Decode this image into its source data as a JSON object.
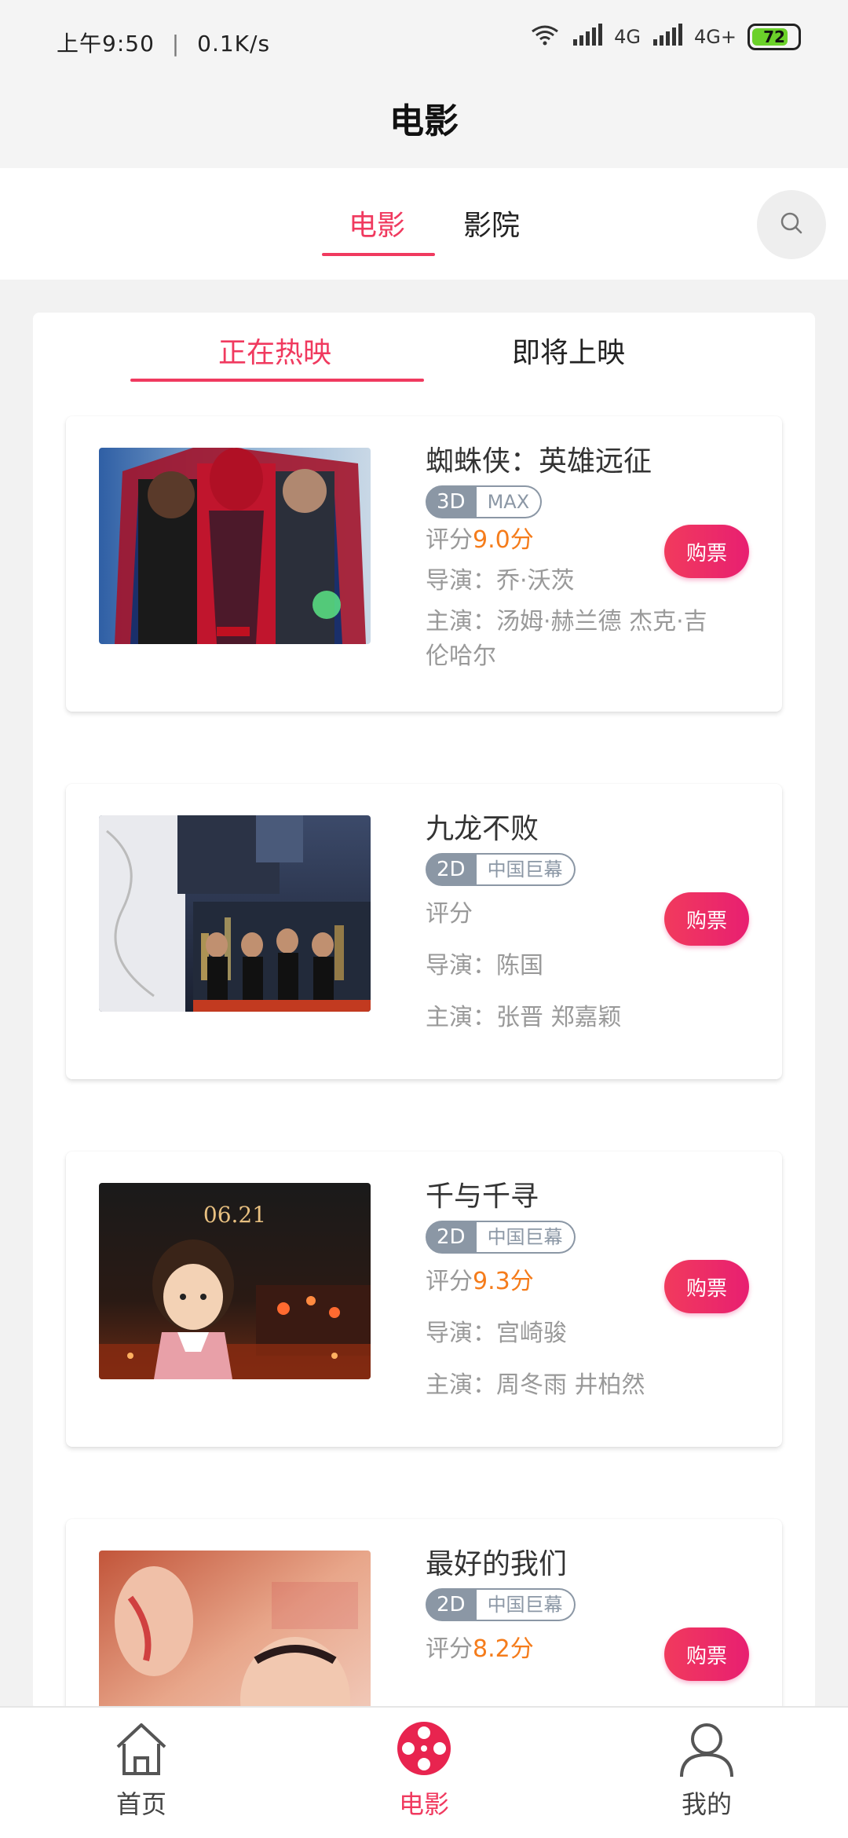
{
  "status_bar": {
    "time": "上午9:50",
    "speed": "0.1K/s",
    "net1": "4G",
    "net2": "4G+",
    "battery": "72"
  },
  "app_title": "电影",
  "top_tabs": [
    {
      "label": "电影",
      "active": true
    },
    {
      "label": "影院",
      "active": false
    }
  ],
  "sub_tabs": [
    {
      "label": "正在热映",
      "active": true
    },
    {
      "label": "即将上映",
      "active": false
    }
  ],
  "movies": [
    {
      "title": "蜘蛛侠：英雄远征",
      "dimension": "3D",
      "format": "MAX",
      "score_label": "评分",
      "score": "9.0分",
      "director": "导演：乔·沃茨",
      "cast": "主演：汤姆·赫兰德 杰克·吉伦哈尔",
      "buy_label": "购票"
    },
    {
      "title": "九龙不败",
      "dimension": "2D",
      "format": "中国巨幕",
      "score_label": "评分",
      "score": "",
      "director": "导演：陈国",
      "cast": "主演：张晋 郑嘉颖",
      "buy_label": "购票"
    },
    {
      "title": "千与千寻",
      "dimension": "2D",
      "format": "中国巨幕",
      "score_label": "评分",
      "score": "9.3分",
      "director": "导演：宫崎骏",
      "cast": "主演：周冬雨 井柏然",
      "buy_label": "购票"
    },
    {
      "title": "最好的我们",
      "dimension": "2D",
      "format": "中国巨幕",
      "score_label": "评分",
      "score": "8.2分",
      "director": "",
      "cast": "",
      "buy_label": "购票"
    }
  ],
  "posters": {
    "poster3_date": "06.21"
  },
  "bottom_nav": [
    {
      "label": "首页",
      "icon": "home-icon",
      "active": false
    },
    {
      "label": "电影",
      "icon": "film-reel-icon",
      "active": true
    },
    {
      "label": "我的",
      "icon": "user-icon",
      "active": false
    }
  ],
  "colors": {
    "accent": "#f03a5f",
    "score": "#f57c1b",
    "tag": "#8b97a5"
  }
}
